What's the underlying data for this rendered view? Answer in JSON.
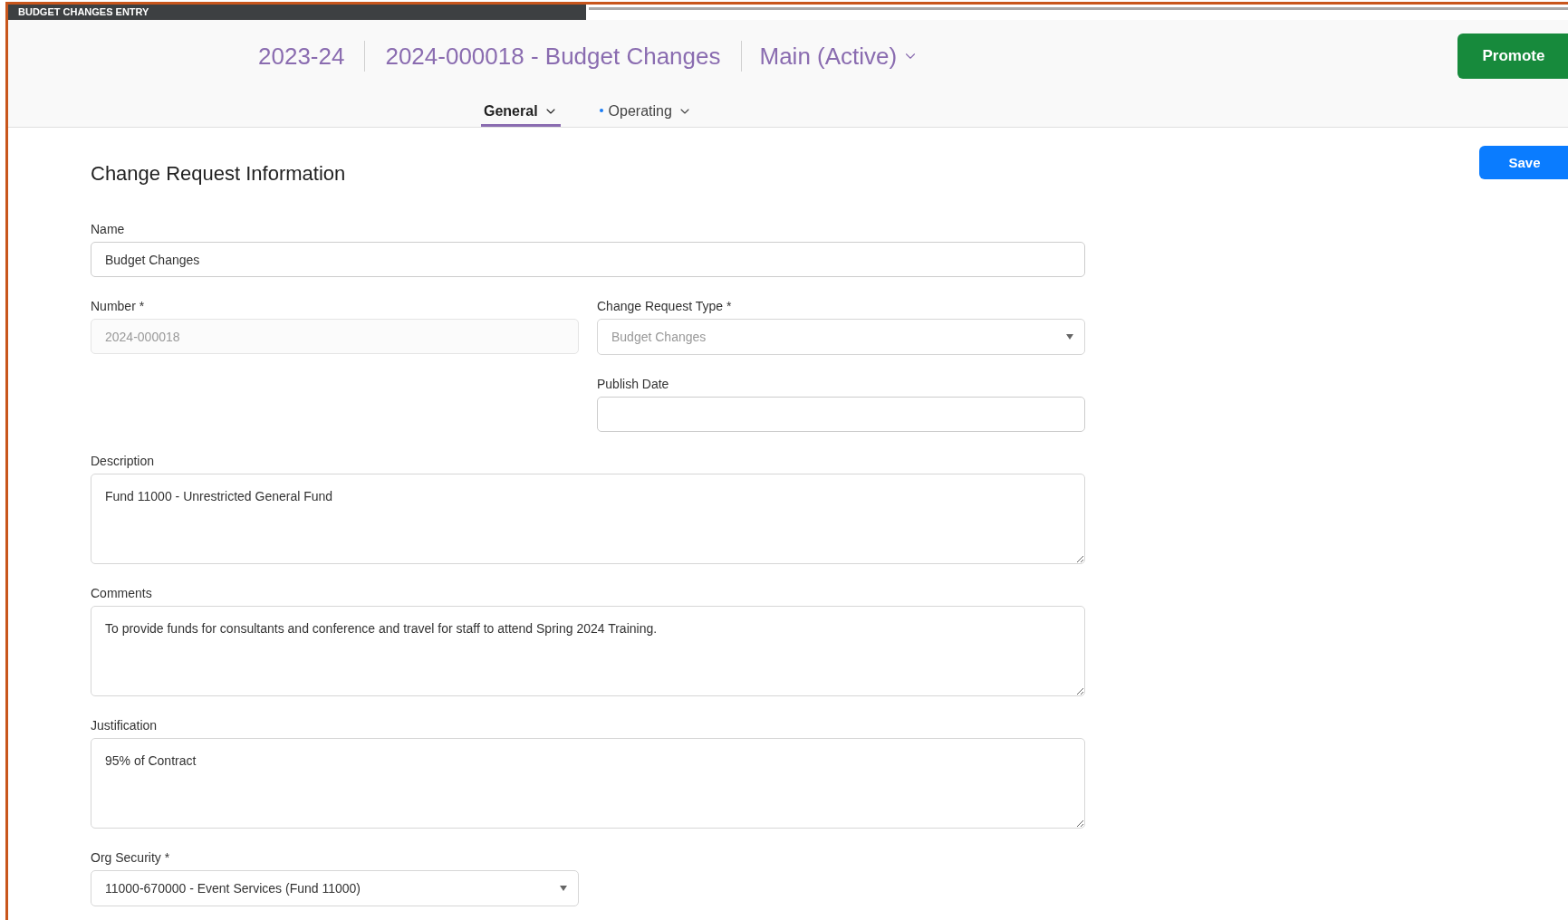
{
  "window": {
    "title": "BUDGET CHANGES ENTRY"
  },
  "header": {
    "crumbs": [
      "2023-24",
      "2024-000018 - Budget Changes"
    ],
    "version": "Main (Active)"
  },
  "promote_button": "Promote",
  "tabs": [
    {
      "label": "General",
      "selected": true,
      "modified": false
    },
    {
      "label": "Operating",
      "selected": false,
      "modified": true
    }
  ],
  "section": {
    "title": "Change Request Information",
    "save_button": "Save"
  },
  "fields": [
    {
      "label": "Name",
      "kind": "text",
      "value": "Budget Changes",
      "disabled": false
    },
    {
      "label": "Number *",
      "kind": "text",
      "value": "2024-000018",
      "disabled": true
    },
    {
      "label": "Change Request Type *",
      "kind": "select",
      "value": "Budget Changes",
      "disabled": true
    },
    {
      "label": "Publish Date",
      "kind": "text",
      "disabled": false
    },
    {
      "label": "Description",
      "kind": "textarea",
      "value": "Fund 11000 - Unrestricted General Fund",
      "disabled": false
    },
    {
      "label": "Comments",
      "kind": "textarea",
      "value": "To provide funds for consultants and conference and travel for staff to attend Spring 2024 Training.",
      "disabled": false
    },
    {
      "label": "Justification",
      "kind": "textarea",
      "value": "95% of Contract",
      "disabled": false
    },
    {
      "label": "Org Security *",
      "kind": "select",
      "value": "11000-670000 - Event Services (Fund 11000)",
      "disabled": false
    }
  ]
}
